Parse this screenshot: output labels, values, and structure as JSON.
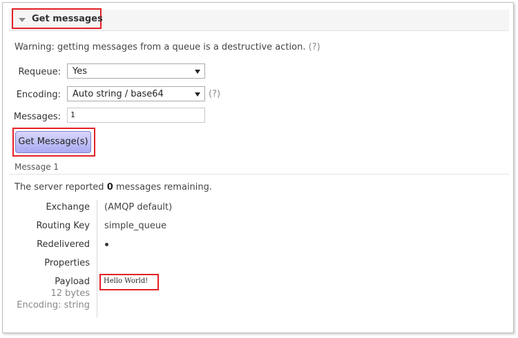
{
  "section": {
    "title": "Get messages"
  },
  "warning": {
    "text": "Warning: getting messages from a queue is a destructive action.",
    "help": "(?)"
  },
  "form": {
    "requeue_label": "Requeue:",
    "requeue_value": "Yes",
    "encoding_label": "Encoding:",
    "encoding_value": "Auto string / base64",
    "encoding_help": "(?)",
    "messages_label": "Messages:",
    "messages_value": "1",
    "submit_label": "Get Message(s)"
  },
  "message": {
    "header": "Message 1",
    "server_prefix": "The server reported",
    "server_count": "0",
    "server_suffix": "messages remaining.",
    "props": {
      "exchange_label": "Exchange",
      "exchange_value": "(AMQP default)",
      "routing_key_label": "Routing Key",
      "routing_key_value": "simple_queue",
      "redelivered_label": "Redelivered",
      "properties_label": "Properties",
      "payload_label": "Payload",
      "payload_size": "12 bytes",
      "payload_encoding": "Encoding: string",
      "payload_value": "Hello World!"
    }
  },
  "colors": {
    "highlight": "#e31f26",
    "button_top": "#d8d8fb",
    "button_bottom": "#a9a9f2"
  }
}
